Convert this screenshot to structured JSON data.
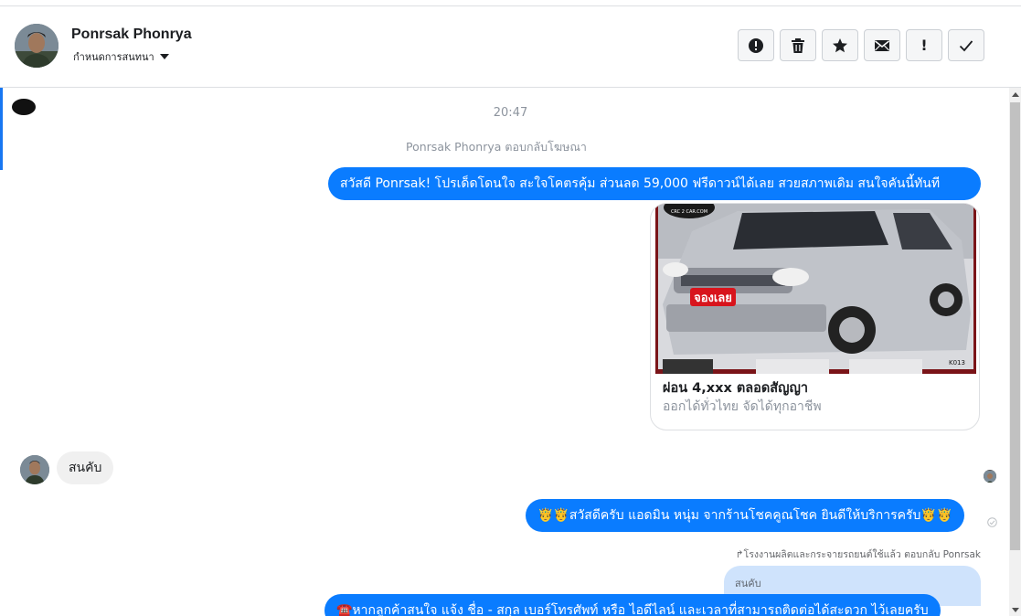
{
  "header": {
    "name": "Ponrsak Phonrya",
    "subtitle": "กำหนดการสนทนา"
  },
  "toolbar": {
    "buttons": [
      {
        "icon": "alert-circle-icon"
      },
      {
        "icon": "trash-icon"
      },
      {
        "icon": "star-icon"
      },
      {
        "icon": "envelope-icon"
      },
      {
        "icon": "exclamation-icon",
        "glyph": "!"
      },
      {
        "icon": "checkmark-icon"
      }
    ]
  },
  "conversation": {
    "time": "20:47",
    "notice": "Ponrsak Phonrya ตอบกลับโฆษณา",
    "message1": "สวัสดี Ponrsak! โปรเด็ดโดนใจ สะใจโคตรคุ้ม ส่วนลด 59,000 ฟรีดาวน์ได้เลย สวยสภาพเดิม สนใจคันนี้ทันที",
    "card": {
      "title": "ผ่อน 4,xxx ตลอดสัญญา",
      "subtitle": "ออกได้ทั่วไทย จัดได้ทุกอาชีพ",
      "image_text_logo": "CRC 2 CAR.COM",
      "image_text_badge": "จองเลย",
      "image_text_code": "K013"
    },
    "message2": "สนคับ",
    "message3": "🤴🤴สวัสดีครับ แอดมิน หนุ่ม จากร้านโชคคูณโชค ยินดีให้บริการครับ🤴🤴",
    "reply_note": "↱โรงงานผลิตและกระจายรถยนต์ใช้แล้ว ตอบกลับ Ponrsak",
    "reply_quote": "สนคับ",
    "message4": "☎️หากลูกค้าสนใจ แจ้ง ชื่อ - สกุล เบอร์โทรศัพท์ หรือ ไอดีไลน์ และเวลาที่สามารถติดต่อได้สะดวก ไว้เลยครับ"
  },
  "colors": {
    "accent": "#0a7cff",
    "incoming": "#f0f0f0",
    "reply": "#cfe3fc"
  }
}
